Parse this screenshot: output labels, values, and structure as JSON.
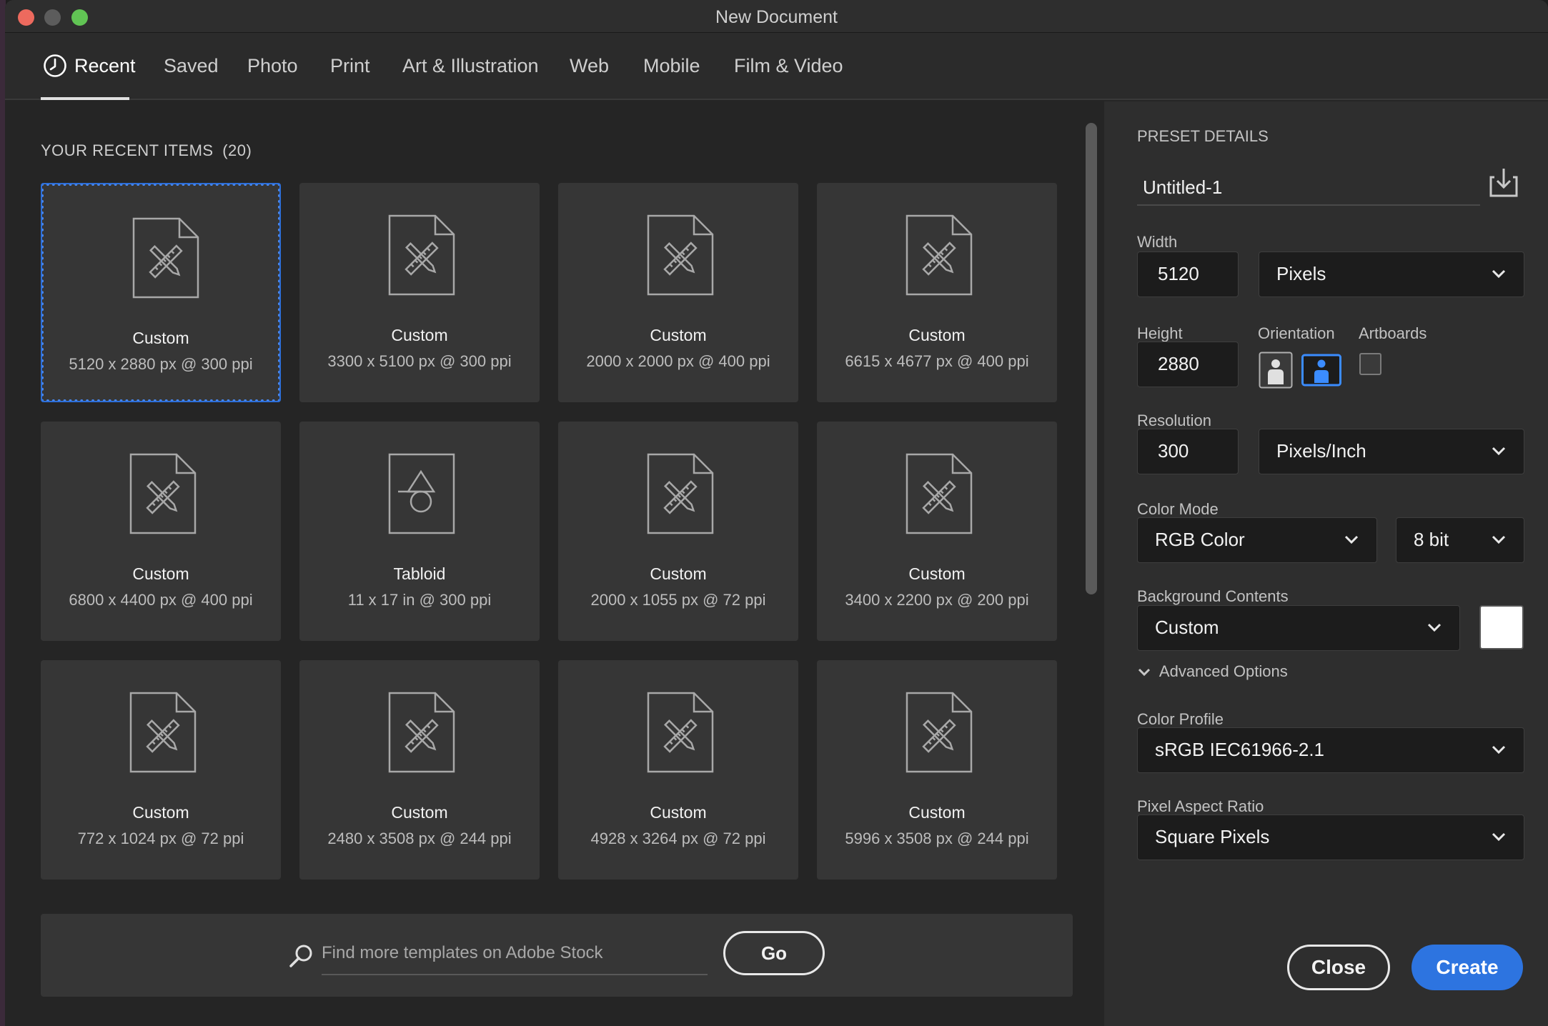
{
  "window": {
    "title": "New Document"
  },
  "tabs": [
    {
      "label": "Recent",
      "icon": "clock-icon",
      "active": true
    },
    {
      "label": "Saved"
    },
    {
      "label": "Photo"
    },
    {
      "label": "Print"
    },
    {
      "label": "Art & Illustration"
    },
    {
      "label": "Web"
    },
    {
      "label": "Mobile"
    },
    {
      "label": "Film & Video"
    }
  ],
  "recent": {
    "header": "YOUR RECENT ITEMS",
    "count": "(20)",
    "items": [
      {
        "name": "Custom",
        "dims": "5120 x 2880 px @ 300 ppi",
        "icon": "custom-document-icon",
        "selected": true
      },
      {
        "name": "Custom",
        "dims": "3300 x 5100 px @ 300 ppi",
        "icon": "custom-document-icon"
      },
      {
        "name": "Custom",
        "dims": "2000 x 2000 px @ 400 ppi",
        "icon": "custom-document-icon"
      },
      {
        "name": "Custom",
        "dims": "6615 x 4677 px @ 400 ppi",
        "icon": "custom-document-icon"
      },
      {
        "name": "Custom",
        "dims": "6800 x 4400 px @ 400 ppi",
        "icon": "custom-document-icon"
      },
      {
        "name": "Tabloid",
        "dims": "11 x 17 in @ 300 ppi",
        "icon": "print-document-icon"
      },
      {
        "name": "Custom",
        "dims": "2000 x 1055 px @ 72 ppi",
        "icon": "custom-document-icon"
      },
      {
        "name": "Custom",
        "dims": "3400 x 2200 px @ 200 ppi",
        "icon": "custom-document-icon"
      },
      {
        "name": "Custom",
        "dims": "772 x 1024 px @ 72 ppi",
        "icon": "custom-document-icon"
      },
      {
        "name": "Custom",
        "dims": "2480 x 3508 px @ 244 ppi",
        "icon": "custom-document-icon"
      },
      {
        "name": "Custom",
        "dims": "4928 x 3264 px @ 72 ppi",
        "icon": "custom-document-icon"
      },
      {
        "name": "Custom",
        "dims": "5996 x 3508 px @ 244 ppi",
        "icon": "custom-document-icon"
      }
    ]
  },
  "stock": {
    "placeholder": "Find more templates on Adobe Stock",
    "go_label": "Go"
  },
  "preset": {
    "header": "PRESET DETAILS",
    "name": "Untitled-1",
    "width_label": "Width",
    "width_value": "5120",
    "width_unit": "Pixels",
    "height_label": "Height",
    "height_value": "2880",
    "orientation_label": "Orientation",
    "orientation_selected": "landscape",
    "artboards_label": "Artboards",
    "artboards_checked": false,
    "resolution_label": "Resolution",
    "resolution_value": "300",
    "resolution_unit": "Pixels/Inch",
    "color_mode_label": "Color Mode",
    "color_mode": "RGB Color",
    "bit_depth": "8 bit",
    "background_label": "Background Contents",
    "background": "Custom",
    "background_color": "#ffffff",
    "advanced_label": "Advanced Options",
    "color_profile_label": "Color Profile",
    "color_profile": "sRGB IEC61966-2.1",
    "pixel_aspect_label": "Pixel Aspect Ratio",
    "pixel_aspect": "Square Pixels"
  },
  "actions": {
    "close_label": "Close",
    "create_label": "Create"
  },
  "colors": {
    "accent": "#2d74e0",
    "selection": "#4a8cf7"
  }
}
